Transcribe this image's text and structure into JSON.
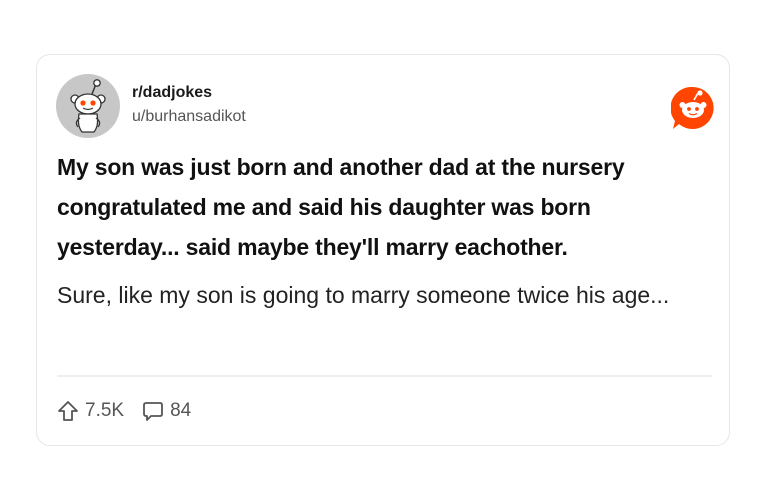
{
  "post": {
    "community": "r/dadjokes",
    "username": "u/burhansadikot",
    "title": "My son was just born and another dad at the nursery congratulated me and said his daughter was born yesterday... said maybe they'll marry eachother.",
    "body": "Sure, like my son is going to marry someone twice his age...",
    "upvotes": "7.5K",
    "comments": "84"
  },
  "icons": {
    "avatar": "snoo-avatar-icon",
    "brand": "reddit-logo-icon",
    "upvote": "upvote-arrow-icon",
    "comment": "comment-bubble-icon"
  },
  "colors": {
    "brand": "#FF4500",
    "avatar_bg": "#C7C7C7"
  }
}
